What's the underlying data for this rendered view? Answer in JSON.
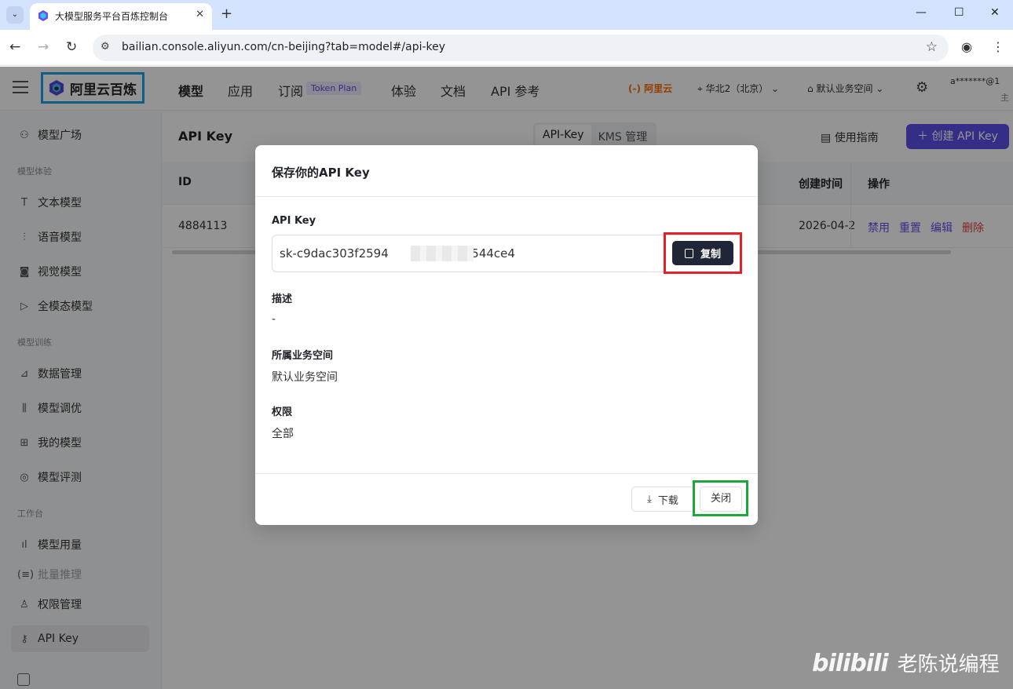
{
  "browser": {
    "tab_title": "大模型服务平台百炼控制台",
    "url": "bailian.console.aliyun.com/cn-beijing?tab=model#/api-key"
  },
  "topnav": {
    "brand": "阿里云百炼",
    "items": [
      "模型",
      "应用",
      "订阅",
      "体验",
      "文档",
      "API 参考"
    ],
    "token_badge": "Token Plan",
    "aliyun": "阿里云",
    "region": "华北2（北京）",
    "workspace": "默认业务空间",
    "account": "a*******@1",
    "account_sub": "主"
  },
  "sidebar": {
    "items": [
      {
        "label": "模型广场",
        "icon": "model-square-icon"
      },
      {
        "group": "模型体验"
      },
      {
        "label": "文本模型",
        "icon": "text-icon"
      },
      {
        "label": "语音模型",
        "icon": "audio-icon"
      },
      {
        "label": "视觉模型",
        "icon": "camera-icon"
      },
      {
        "label": "全模态模型",
        "icon": "omni-icon"
      },
      {
        "group": "模型训练"
      },
      {
        "label": "数据管理",
        "icon": "chart-icon"
      },
      {
        "label": "模型调优",
        "icon": "sliders-icon"
      },
      {
        "label": "我的模型",
        "icon": "grid-icon"
      },
      {
        "label": "模型评测",
        "icon": "compass-icon"
      },
      {
        "group": "工作台"
      },
      {
        "label": "模型用量",
        "icon": "bar-chart-icon"
      },
      {
        "label": "批量推理",
        "icon": "batch-icon"
      },
      {
        "label": "权限管理",
        "icon": "user-icon"
      },
      {
        "label": "API Key",
        "icon": "key-icon"
      }
    ]
  },
  "main": {
    "title": "API Key",
    "segments": [
      "API-Key",
      "KMS 管理"
    ],
    "guide": "使用指南",
    "create": "创建 API Key",
    "columns": {
      "id": "ID",
      "created": "创建时间",
      "ops": "操作"
    },
    "row": {
      "id": "4884113",
      "created": "2026-04-2",
      "actions": [
        "禁用",
        "重置",
        "编辑",
        "删除"
      ]
    }
  },
  "modal": {
    "title": "保存你的API Key",
    "key_label": "API Key",
    "key_prefix": "sk-c9dac303f2594",
    "key_suffix": "3544ce4",
    "copy": "复制",
    "desc_label": "描述",
    "desc_value": "-",
    "workspace_label": "所属业务空间",
    "workspace_value": "默认业务空间",
    "perm_label": "权限",
    "perm_value": "全部",
    "download": "下载",
    "close": "关闭"
  },
  "watermark": {
    "logo": "bilibili",
    "text": "老陈说编程"
  },
  "colors": {
    "accent": "#5b50e8",
    "highlight_red": "#e4202c",
    "highlight_green": "#1ea83c",
    "highlight_blue": "#1ea1e8"
  }
}
